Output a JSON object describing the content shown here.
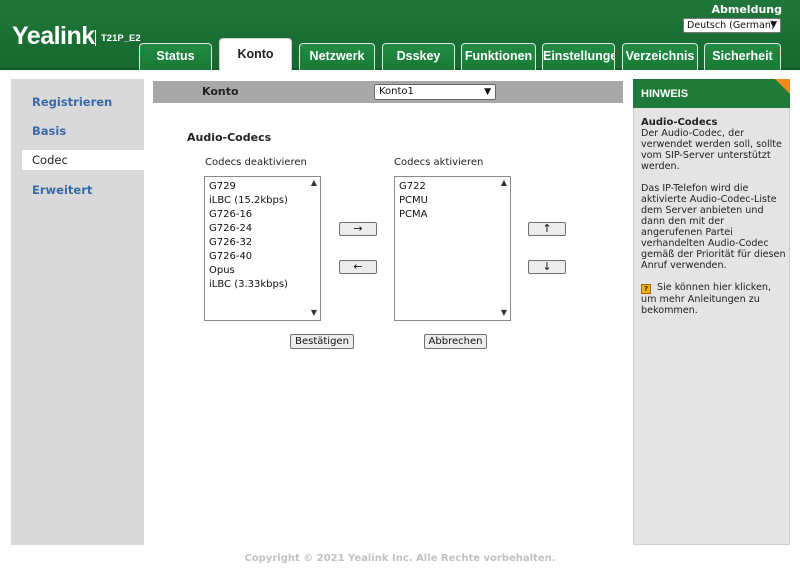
{
  "header": {
    "logo": "Yealink",
    "model": "T21P_E2",
    "logout": "Abmeldung",
    "language": "Deutsch (German)"
  },
  "tabs": [
    {
      "label": "Status"
    },
    {
      "label": "Konto"
    },
    {
      "label": "Netzwerk"
    },
    {
      "label": "Dsskey"
    },
    {
      "label": "Funktionen"
    },
    {
      "label": "Einstellungen"
    },
    {
      "label": "Verzeichnis"
    },
    {
      "label": "Sicherheit"
    }
  ],
  "sidebar": {
    "items": [
      {
        "label": "Registrieren"
      },
      {
        "label": "Basis"
      },
      {
        "label": "Codec"
      },
      {
        "label": "Erweitert"
      }
    ]
  },
  "account": {
    "label": "Konto",
    "selected": "Konto1"
  },
  "codec": {
    "section_title": "Audio-Codecs",
    "disabled_label": "Codecs deaktivieren",
    "enabled_label": "Codecs aktivieren",
    "disabled": [
      "G729",
      "iLBC (15.2kbps)",
      "G726-16",
      "G726-24",
      "G726-32",
      "G726-40",
      "Opus",
      "iLBC (3.33kbps)"
    ],
    "enabled": [
      "G722",
      "PCMU",
      "PCMA"
    ],
    "move_right": "→",
    "move_left": "←",
    "move_up": "↑",
    "move_down": "↓",
    "confirm": "Bestätigen",
    "cancel": "Abbrechen"
  },
  "hint": {
    "title": "HINWEIS",
    "heading": "Audio-Codecs",
    "para1": "Der Audio-Codec, der verwendet werden soll, sollte vom SIP-Server unterstützt werden.",
    "para2": "Das IP-Telefon wird die aktivierte Audio-Codec-Liste dem Server anbieten und dann den mit der angerufenen Partei verhandelten Audio-Codec gemäß der Priorität für diesen Anruf verwenden.",
    "help_text": "Sie können hier klicken, um mehr Anleitungen zu bekommen.",
    "help_icon": "?"
  },
  "footer": "Copyright © 2021 Yealink Inc. Alle Rechte vorbehalten.",
  "colors": {
    "brand_green": "#1a6e33",
    "accent_orange": "#f08a1c",
    "sidebar_link": "#3a6aa6"
  }
}
